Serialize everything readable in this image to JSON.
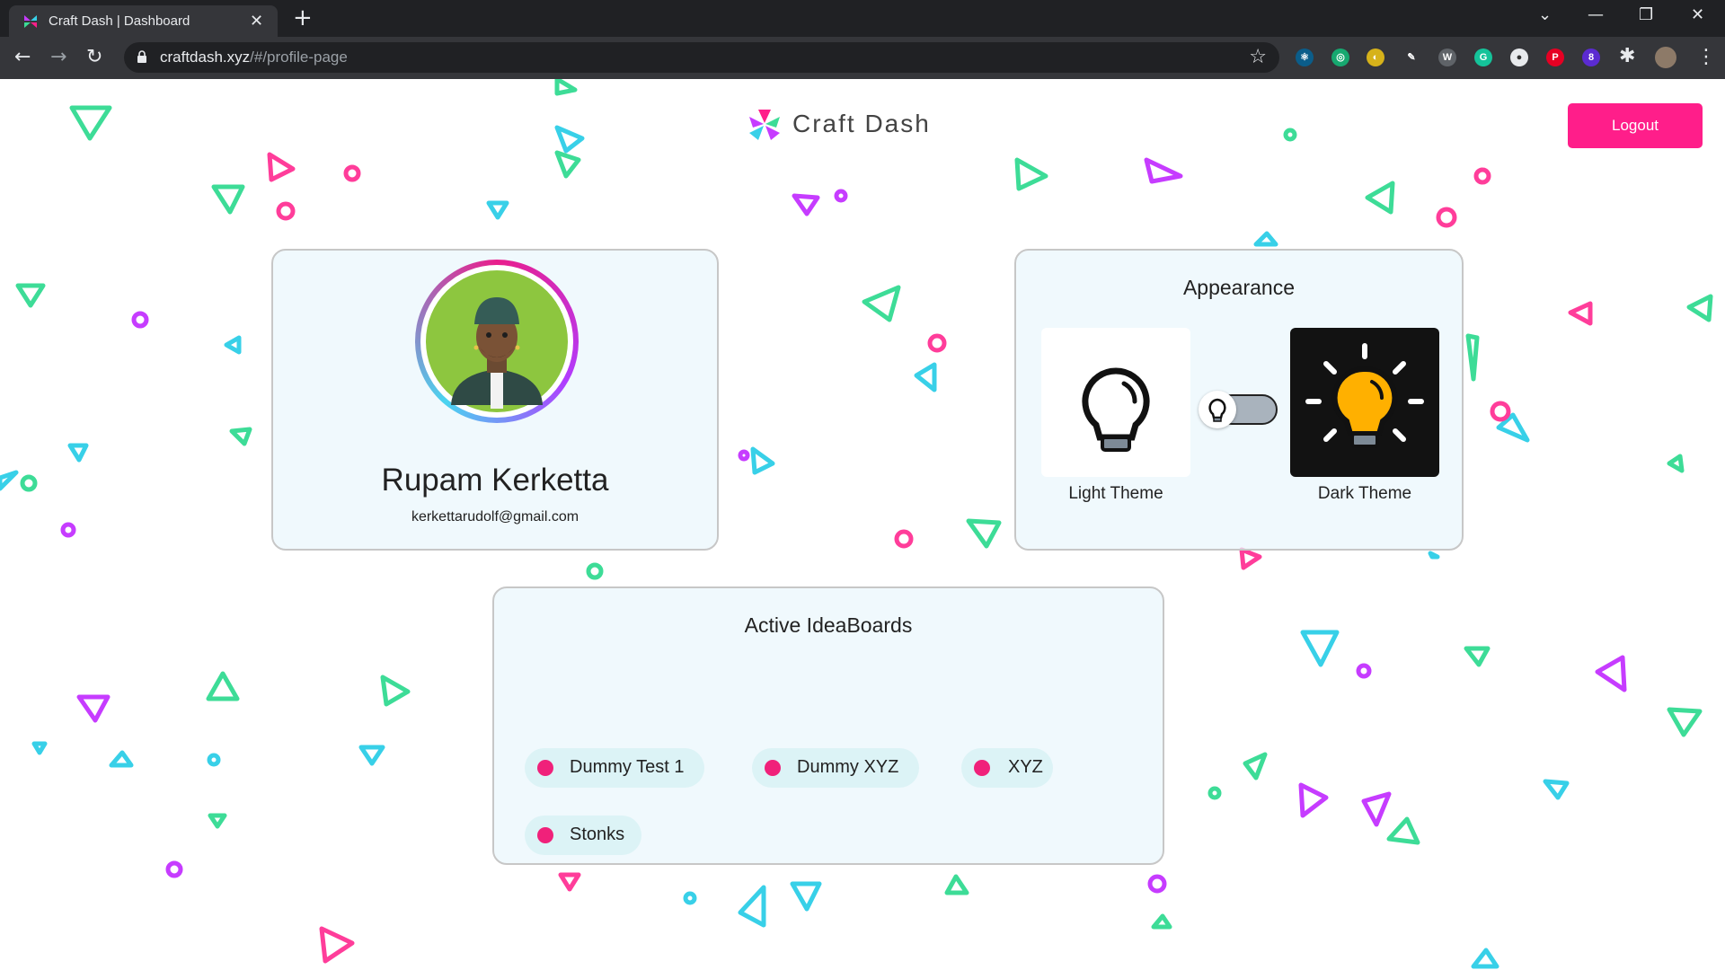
{
  "browser": {
    "tab_title": "Craft Dash | Dashboard",
    "url_host": "craftdash.xyz",
    "url_path": "/#/profile-page",
    "extension_badge": "8"
  },
  "header": {
    "logo_text": "Craft Dash",
    "logout_label": "Logout"
  },
  "profile": {
    "name": "Rupam Kerketta",
    "email": "kerkettarudolf@gmail.com"
  },
  "appearance": {
    "heading": "Appearance",
    "light_label": "Light Theme",
    "dark_label": "Dark Theme",
    "mode": "light"
  },
  "ideaboards": {
    "heading": "Active IdeaBoards",
    "items": [
      "Dummy Test 1",
      "Dummy XYZ",
      "XYZ",
      "Stonks"
    ]
  },
  "colors": {
    "accent": "#ff1e8a",
    "dot": "#f0217a",
    "confetti_pink": "#ff3d9a",
    "confetti_purple": "#c63cff",
    "confetti_green": "#3ddc97",
    "confetti_cyan": "#38d0e8"
  }
}
